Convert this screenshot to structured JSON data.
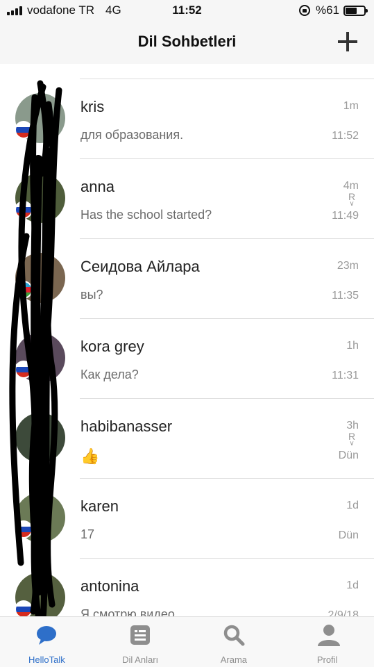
{
  "status_bar": {
    "carrier": "vodafone TR",
    "network": "4G",
    "time": "11:52",
    "battery": "%61",
    "battery_level": 0.61
  },
  "header": {
    "title": "Dil Sohbetleri",
    "add_icon": "plus-icon"
  },
  "chats": [
    {
      "name": "kris",
      "message": "для образования.",
      "rel_time": "1m",
      "abs_time": "11:52",
      "read": "",
      "flag": "russia"
    },
    {
      "name": "anna",
      "message": "Has the school started?",
      "rel_time": "4m",
      "abs_time": "11:49",
      "read": "R",
      "flag": "russia"
    },
    {
      "name": "Сеидова Айлара",
      "message": "вы?",
      "rel_time": "23m",
      "abs_time": "11:35",
      "read": "",
      "flag": "azerbaijan"
    },
    {
      "name": "kora grey",
      "message": "Как дела?",
      "rel_time": "1h",
      "abs_time": "11:31",
      "read": "",
      "flag": "russia"
    },
    {
      "name": "habibanasser",
      "message": "👍",
      "rel_time": "3h",
      "abs_time": "Dün",
      "read": "R",
      "flag": "none"
    },
    {
      "name": "karen",
      "message": "17",
      "rel_time": "1d",
      "abs_time": "Dün",
      "read": "",
      "flag": "russia"
    },
    {
      "name": "antonina",
      "message": "Я смотрю видео",
      "rel_time": "1d",
      "abs_time": "2/9/18",
      "read": "",
      "flag": "russia"
    }
  ],
  "tabs": [
    {
      "label": "HelloTalk",
      "icon": "chat-bubble-icon",
      "active": true
    },
    {
      "label": "Dil Anları",
      "icon": "moments-icon",
      "active": false
    },
    {
      "label": "Arama",
      "icon": "search-icon",
      "active": false
    },
    {
      "label": "Profil",
      "icon": "profile-icon",
      "active": false
    }
  ],
  "colors": {
    "accent": "#2e6fc9",
    "inactive_tab": "#8e8e8e",
    "separator": "#dedede"
  }
}
